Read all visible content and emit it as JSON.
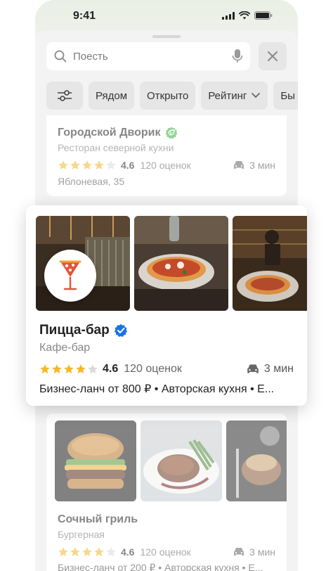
{
  "status": {
    "time": "9:41"
  },
  "search": {
    "placeholder": "Поесть"
  },
  "chips": [
    "Рядом",
    "Открыто",
    "Рейтинг",
    "Бы"
  ],
  "places": [
    {
      "name": "Городской Дворик",
      "category": "Ресторан северной кухни",
      "rating": "4.6",
      "rating_stars": 4,
      "reviews": "120 оценок",
      "drive_time": "3 мин",
      "address": "Яблоневая, 35",
      "badge": "leaf"
    },
    {
      "name": "Пицца-бар",
      "category": "Кафе-бар",
      "rating": "4.6",
      "rating_stars": 4,
      "reviews": "120 оценок",
      "drive_time": "3 мин",
      "features": "Бизнес-ланч от 800 ₽ • Авторская кухня • E...",
      "badge": "verified"
    },
    {
      "name": "Сочный гриль",
      "category": "Бургерная",
      "rating": "4.6",
      "rating_stars": 4,
      "reviews": "120 оценок",
      "drive_time": "3 мин",
      "features": "Бизнес-ланч от 200 ₽ • Авторская кухня • E..."
    }
  ],
  "colors": {
    "star": "#f5b72a",
    "star_empty": "#d9d9d9",
    "verified": "#1a73e8",
    "leaf_badge": "#3cb043",
    "logo_accent": "#e5533b"
  }
}
